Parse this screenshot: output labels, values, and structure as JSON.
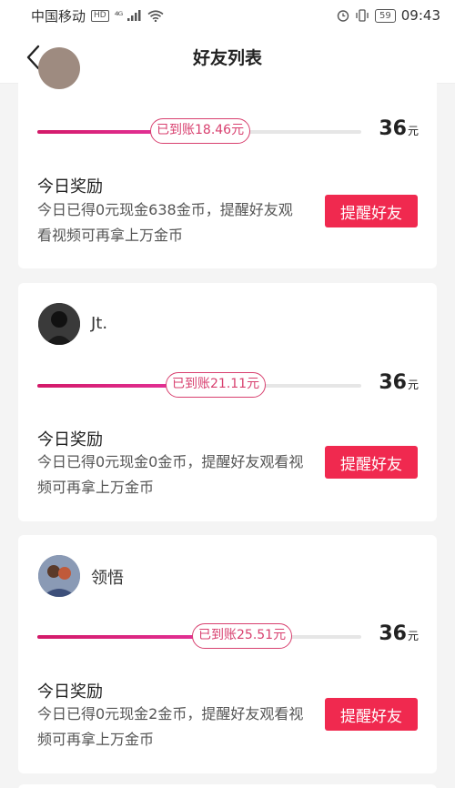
{
  "status_bar": {
    "carrier": "中国移动",
    "hd": "HD",
    "signal": "⁴ᴳ",
    "battery": "59",
    "time": "09:43"
  },
  "navbar": {
    "title": "好友列表"
  },
  "cards": [
    {
      "name": "",
      "progress_label": "已到账18.46元",
      "progress_fraction": 0.51,
      "amount": "36",
      "unit": "元",
      "reward_title": "今日奖励",
      "reward_desc": "今日已得0元现金638金币，提醒好友观看视频可再拿上万金币",
      "button": "提醒好友"
    },
    {
      "name": "Jt.",
      "progress_label": "已到账21.11元",
      "progress_fraction": 0.59,
      "amount": "36",
      "unit": "元",
      "reward_title": "今日奖励",
      "reward_desc": "今日已得0元现金0金币，提醒好友观看视频可再拿上万金币",
      "button": "提醒好友"
    },
    {
      "name": "领悟",
      "progress_label": "已到账25.51元",
      "progress_fraction": 0.71,
      "amount": "36",
      "unit": "元",
      "reward_title": "今日奖励",
      "reward_desc": "今日已得0元现金2金币，提醒好友观看视频可再拿上万金币",
      "button": "提醒好友"
    }
  ],
  "colors": {
    "accent_button": "#f0294f",
    "progress_start": "#d31968",
    "progress_end": "#e83aa7",
    "pill_border": "#d8406f"
  }
}
